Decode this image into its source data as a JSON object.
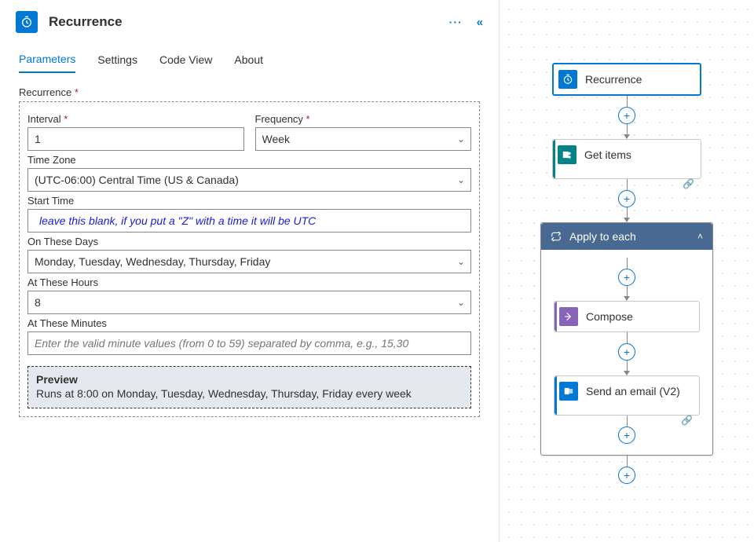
{
  "panel": {
    "title": "Recurrence",
    "ellipsis": "···",
    "collapse": "«"
  },
  "tabs": {
    "parameters": "Parameters",
    "settings": "Settings",
    "codeview": "Code View",
    "about": "About"
  },
  "form": {
    "section_label": "Recurrence",
    "interval_label": "Interval",
    "interval_value": "1",
    "frequency_label": "Frequency",
    "frequency_value": "Week",
    "timezone_label": "Time Zone",
    "timezone_value": "(UTC-06:00) Central Time (US & Canada)",
    "starttime_label": "Start Time",
    "starttime_note": "leave this blank, if you put a \"Z\" with a time it will be UTC",
    "days_label": "On These Days",
    "days_value": "Monday, Tuesday, Wednesday, Thursday, Friday",
    "hours_label": "At These Hours",
    "hours_value": "8",
    "minutes_label": "At These Minutes",
    "minutes_placeholder": "Enter the valid minute values (from 0 to 59) separated by comma, e.g., 15,30",
    "preview_title": "Preview",
    "preview_text": "Runs at 8:00 on Monday, Tuesday, Wednesday, Thursday, Friday every week"
  },
  "flow": {
    "recurrence": "Recurrence",
    "get_items": "Get items",
    "apply_to_each": "Apply to each",
    "compose": "Compose",
    "send_email": "Send an email (V2)"
  }
}
